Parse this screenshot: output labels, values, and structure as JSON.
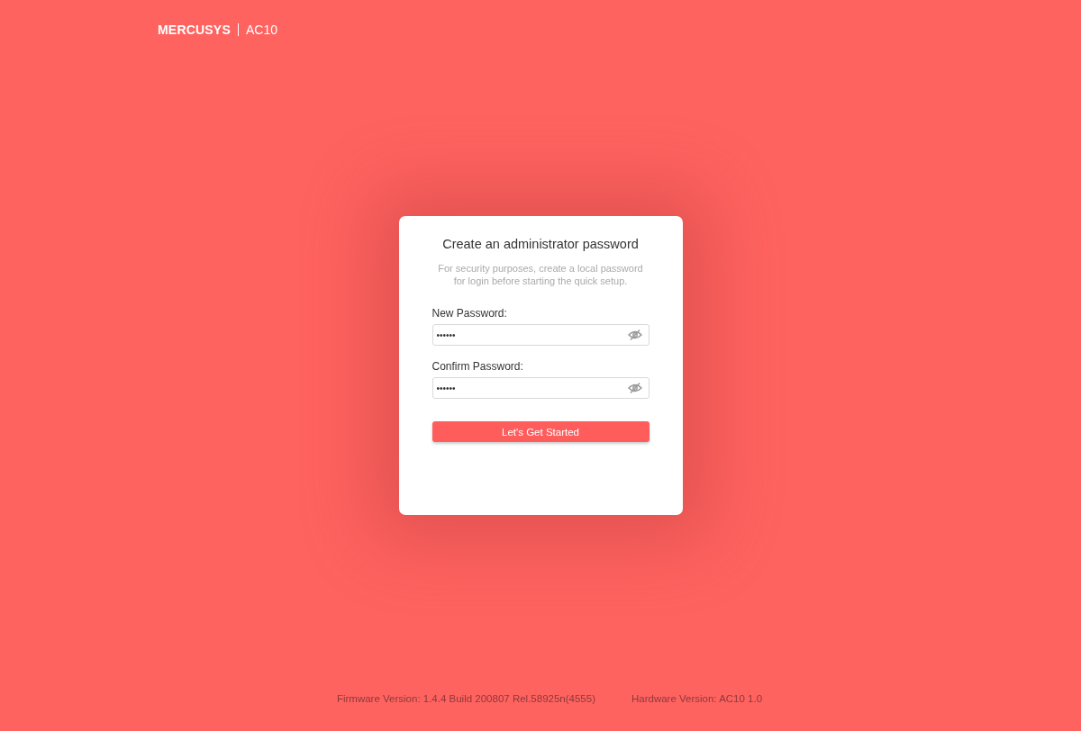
{
  "header": {
    "logo": "MERCUSYS",
    "model": "AC10"
  },
  "card": {
    "title": "Create an administrator password",
    "description": "For security purposes, create a local password for login before starting the quick setup.",
    "fields": [
      {
        "label": "New Password:",
        "value": "••••••"
      },
      {
        "label": "Confirm Password:",
        "value": "••••••"
      }
    ],
    "button": "Let's Get Started"
  },
  "footer": {
    "firmware": "Firmware Version: 1.4.4 Build 200807 Rel.58925n(4555)",
    "hardware": "Hardware Version: AC10 1.0"
  }
}
